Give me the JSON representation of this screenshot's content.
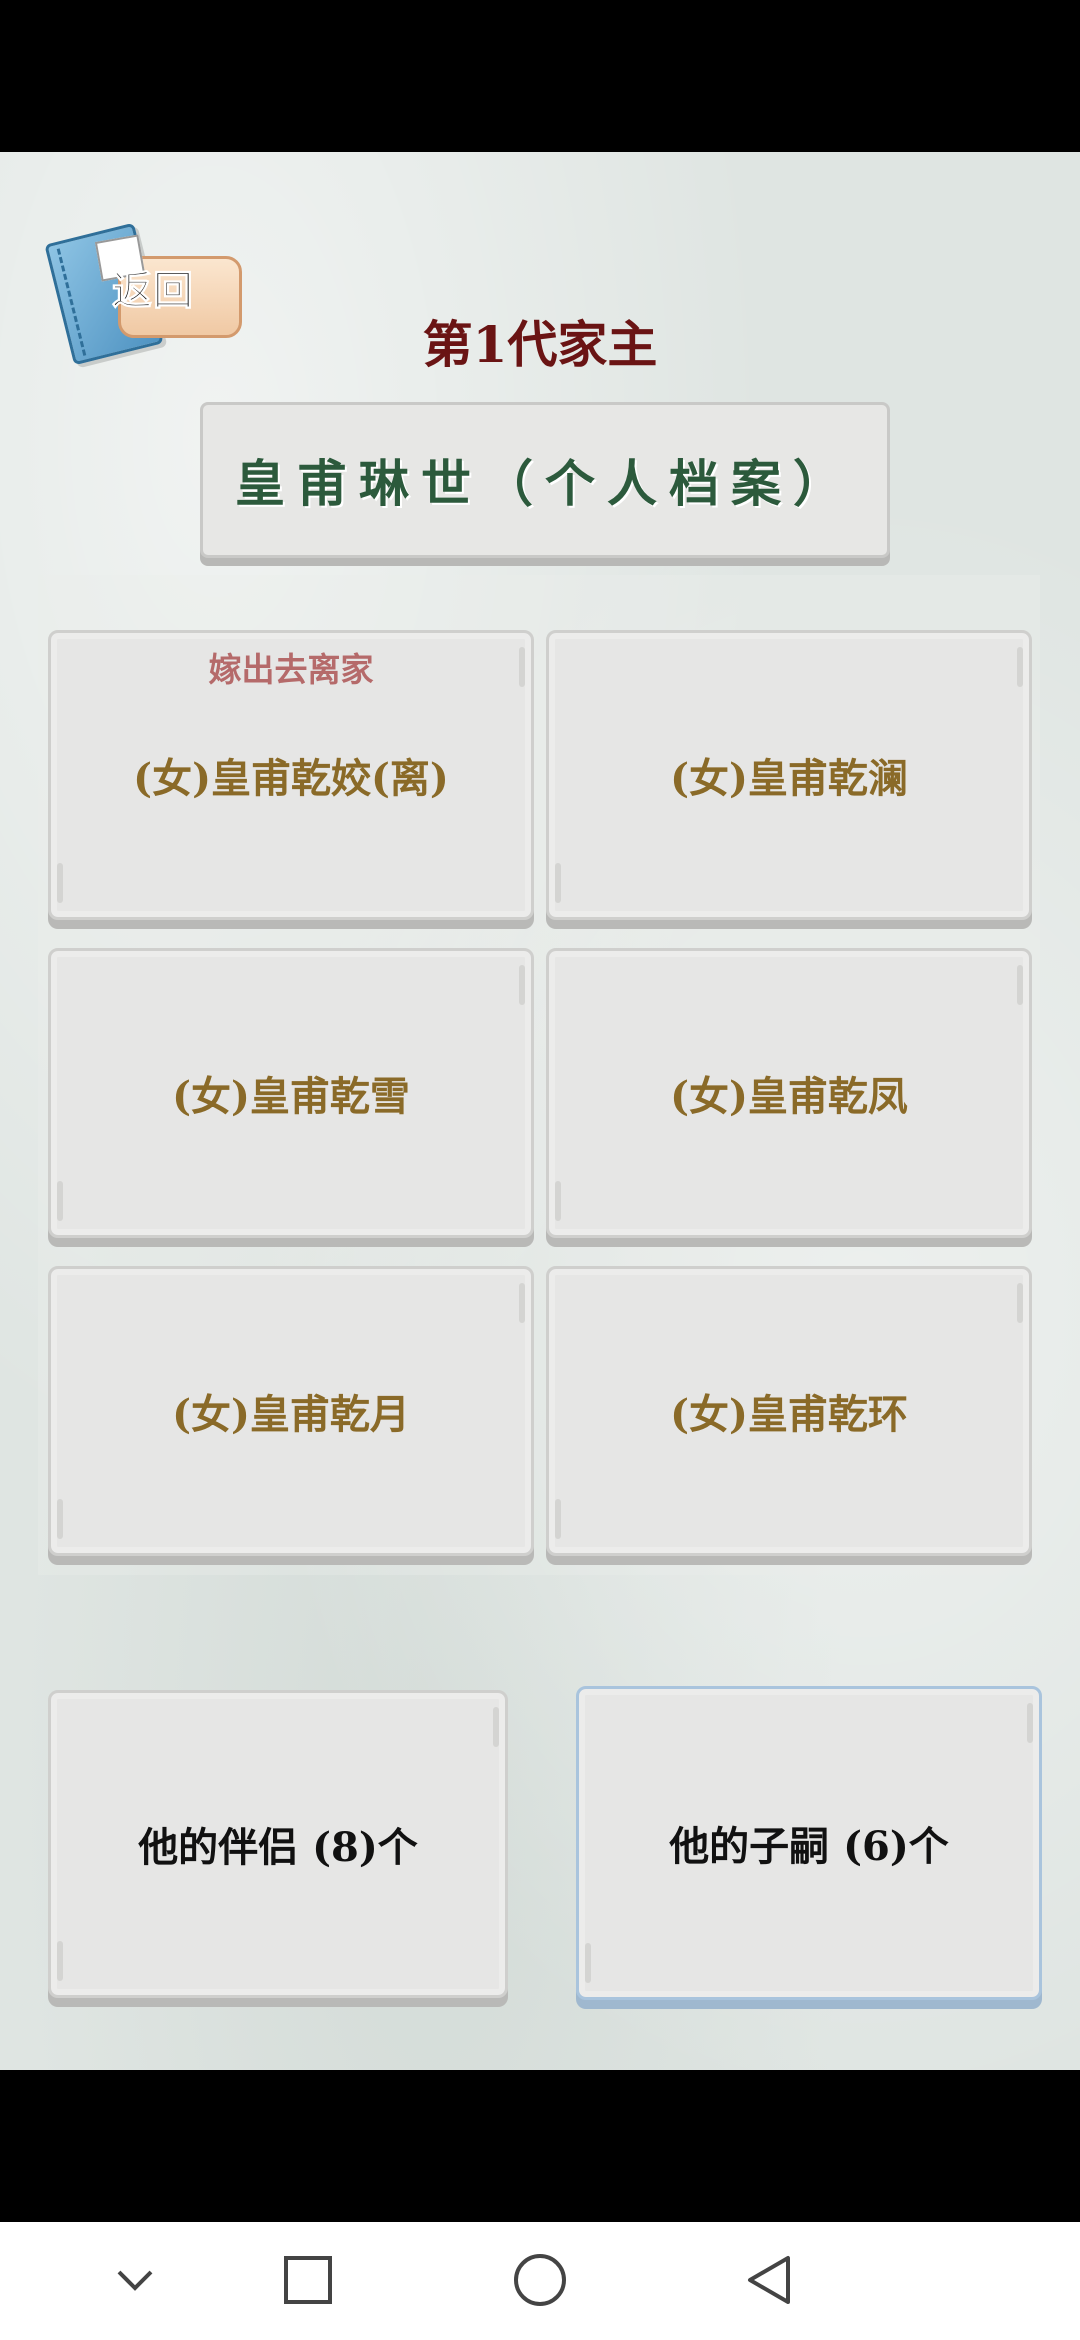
{
  "header": {
    "back_label": "返回",
    "generation_title": "第1代家主",
    "profile_button": "皇甫琳世（个人档案）"
  },
  "children": [
    {
      "name": "(女)皇甫乾姣(离)",
      "status": "嫁出去离家"
    },
    {
      "name": "(女)皇甫乾澜",
      "status": ""
    },
    {
      "name": "(女)皇甫乾雪",
      "status": ""
    },
    {
      "name": "(女)皇甫乾凤",
      "status": ""
    },
    {
      "name": "(女)皇甫乾月",
      "status": ""
    },
    {
      "name": "(女)皇甫乾环",
      "status": ""
    }
  ],
  "bottom_buttons": {
    "partners": "他的伴侣 (8)个",
    "children": "他的子嗣 (6)个",
    "selected": "children"
  },
  "nav": {
    "icons": [
      "chevron-down-icon",
      "square-icon",
      "circle-icon",
      "back-triangle-icon"
    ]
  },
  "colors": {
    "title": "#6a1414",
    "profile_text": "#2c5a3c",
    "child_name": "#8a6a28",
    "status_text": "#b56a6a"
  }
}
